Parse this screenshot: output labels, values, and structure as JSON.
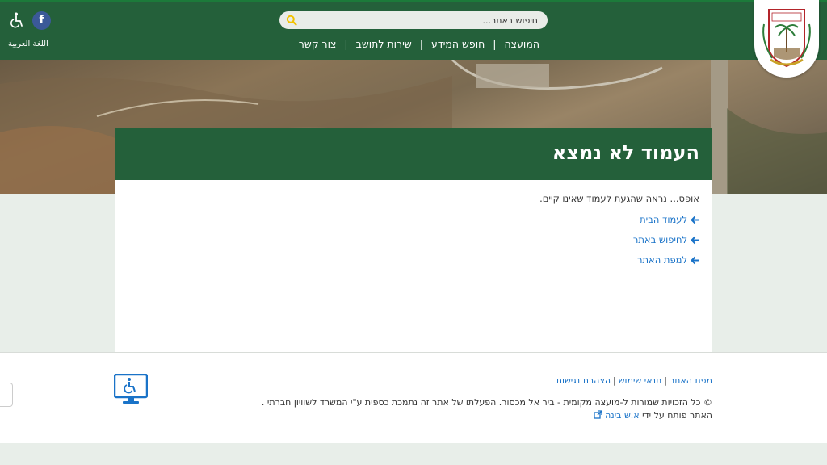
{
  "header": {
    "search_placeholder": "חיפוש באתר...",
    "nav": [
      "המועצה",
      "חופש המידע",
      "שירות לתושב",
      "צור קשר"
    ],
    "facebook_label": "f",
    "arabic_label": "اللغة العربية"
  },
  "main": {
    "title": "העמוד לא נמצא",
    "message": "אופס... נראה שהגעת לעמוד שאינו קיים.",
    "links": [
      "לעמוד הבית",
      "לחיפוש באתר",
      "למפת האתר"
    ]
  },
  "footer": {
    "links": [
      "מפת האתר",
      "תנאי שימוש",
      "הצהרת נגישות"
    ],
    "copyright": "© כל הזכויות שמורות ל-מועצה מקומית - ביר אל מכסור. הפעלתו של אתר זה נתמכת כספית ע\"י המשרד לשוויון חברתי .",
    "developer_prefix": "האתר פותח על ידי",
    "developer_name": "א.ש בינה"
  },
  "colors": {
    "brand_green": "#24603a",
    "link_blue": "#1a73c8",
    "search_icon": "#f2c200",
    "facebook": "#3b5998"
  },
  "icons": [
    "search-icon",
    "facebook-icon",
    "accessibility-icon",
    "arrow-left-icon",
    "external-link-icon",
    "accessibility-monitor-icon",
    "logo-emblem"
  ]
}
